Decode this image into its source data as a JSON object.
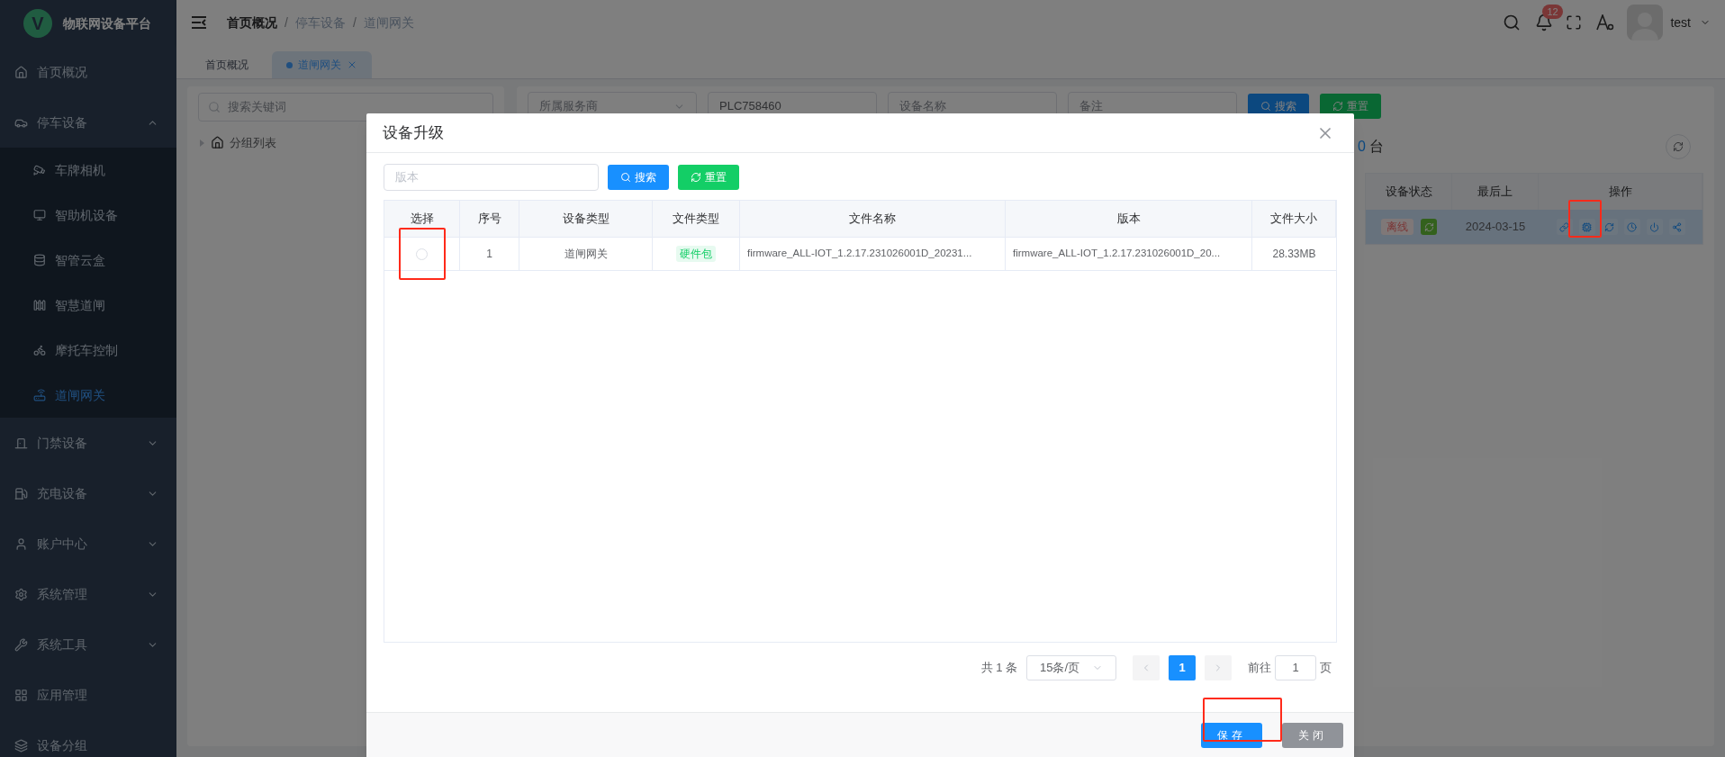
{
  "sidebar": {
    "logo_letter": "V",
    "title": "物联网设备平台",
    "items": [
      {
        "kind": "link",
        "label": "首页概况",
        "selected": false
      },
      {
        "kind": "group",
        "label": "停车设备",
        "expanded": true,
        "children": [
          {
            "label": "车牌相机",
            "selected": false
          },
          {
            "label": "智助机设备",
            "selected": false
          },
          {
            "label": "智管云盒",
            "selected": false
          },
          {
            "label": "智慧道闸",
            "selected": false
          },
          {
            "label": "摩托车控制",
            "selected": false
          },
          {
            "label": "道闸网关",
            "selected": true
          }
        ]
      },
      {
        "kind": "group",
        "label": "门禁设备",
        "expanded": false
      },
      {
        "kind": "group",
        "label": "充电设备",
        "expanded": false
      },
      {
        "kind": "group",
        "label": "账户中心",
        "expanded": false
      },
      {
        "kind": "group",
        "label": "系统管理",
        "expanded": false
      },
      {
        "kind": "group",
        "label": "系统工具",
        "expanded": false
      },
      {
        "kind": "link",
        "label": "应用管理",
        "selected": false
      },
      {
        "kind": "link",
        "label": "设备分组",
        "selected": false
      }
    ]
  },
  "header": {
    "breadcrumb": [
      "首页概况",
      "停车设备",
      "道闸网关"
    ],
    "separator": "/",
    "notification_count": "12",
    "user": "test"
  },
  "tabs": [
    {
      "label": "首页概况",
      "selected": false,
      "closable": false
    },
    {
      "label": "道闸网关",
      "selected": true,
      "closable": true
    }
  ],
  "left_panel": {
    "search_placeholder": "搜索关键词",
    "tree": [
      {
        "label": "分组列表",
        "expanded": false
      }
    ]
  },
  "filters": [
    {
      "kind": "select",
      "placeholder": "所属服务商"
    },
    {
      "kind": "input",
      "value": "PLC758460"
    },
    {
      "kind": "input",
      "placeholder": "设备名称"
    },
    {
      "kind": "input",
      "placeholder": "备注"
    }
  ],
  "filter_buttons": {
    "search": "搜索",
    "reset": "重置"
  },
  "device_count": {
    "value": "0",
    "unit": "台"
  },
  "device_table": {
    "columns": [
      "设备状态",
      "最后上",
      "操作"
    ],
    "rows": [
      {
        "selected": true,
        "status": "离线",
        "last_time": "2024-03-15"
      }
    ]
  },
  "dialog": {
    "title": "设备升级",
    "search_placeholder": "版本",
    "search_button": "搜索",
    "reset_button": "重置",
    "columns": [
      "选择",
      "序号",
      "设备类型",
      "文件类型",
      "文件名称",
      "版本",
      "文件大小"
    ],
    "rows": [
      {
        "selected": false,
        "index": "1",
        "device_type": "道闸网关",
        "file_type": "硬件包",
        "file_name": "firmware_ALL-IOT_1.2.17.231026001D_20231...",
        "version": "firmware_ALL-IOT_1.2.17.231026001D_20...",
        "size": "28.33MB"
      }
    ],
    "pagination": {
      "total": "共 1 条",
      "page_size": "15条/页",
      "pages": [
        {
          "label": "1",
          "selected": true
        }
      ],
      "goto": "前往",
      "goto_value": "1",
      "goto_unit": "页"
    },
    "save_button": "保存",
    "close_button": "关闭"
  }
}
